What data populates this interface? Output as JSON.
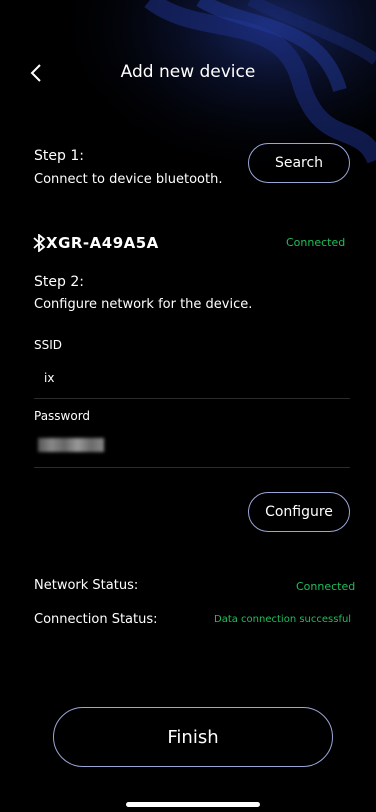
{
  "header": {
    "title": "Add new device"
  },
  "step1": {
    "label": "Step 1:",
    "desc": "Connect to device bluetooth.",
    "search_label": "Search"
  },
  "device": {
    "name": "XGR-A49A5A",
    "status": "Connected"
  },
  "step2": {
    "label": "Step 2:",
    "desc": "Configure network for the device."
  },
  "ssid": {
    "label": "SSID",
    "value": "ix"
  },
  "password": {
    "label": "Password"
  },
  "configure_label": "Configure",
  "network_status": {
    "label": "Network Status:",
    "value": "Connected"
  },
  "connection_status": {
    "label": "Connection Status:",
    "value": "Data connection successful"
  },
  "finish_label": "Finish",
  "colors": {
    "accent_green": "#1fbf5a",
    "button_border": "#9aa6d6",
    "background": "#000000"
  },
  "icons": {
    "back": "chevron-left-icon",
    "bluetooth": "bluetooth-icon"
  }
}
